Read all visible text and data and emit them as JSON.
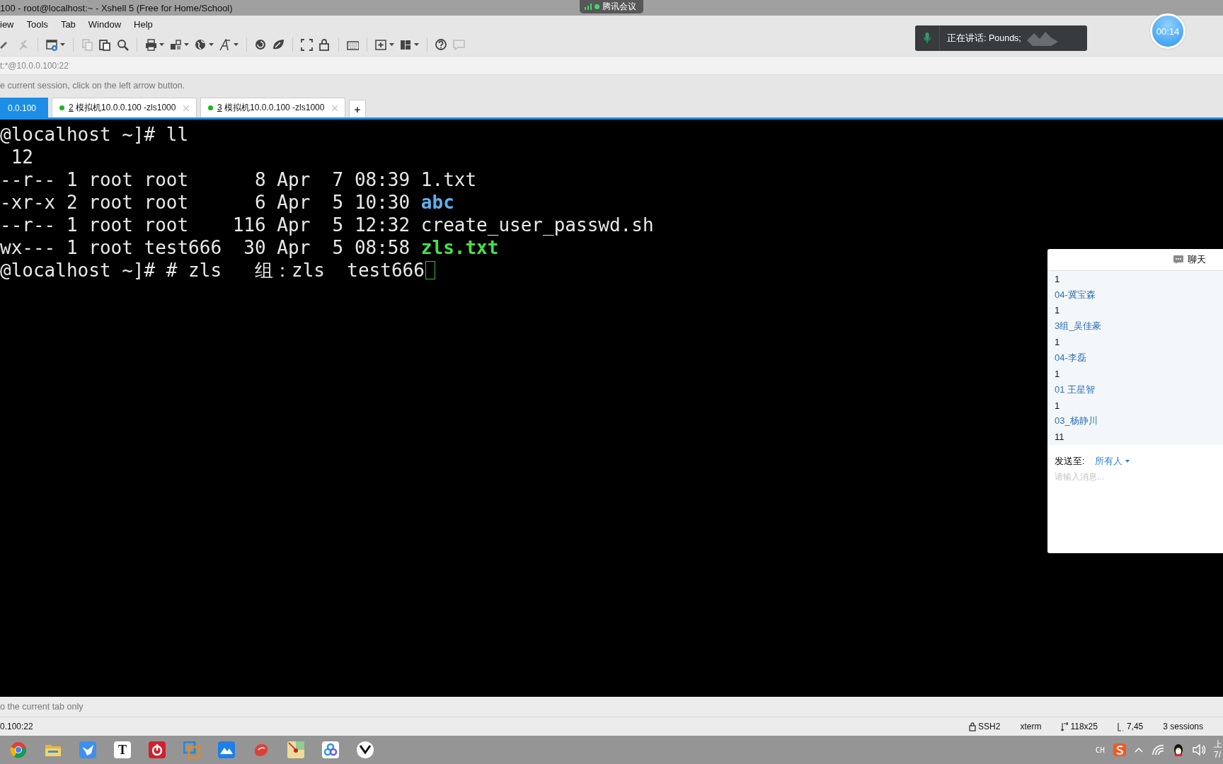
{
  "window": {
    "title": "100 - root@localhost:~ - Xshell 5 (Free for Home/School)"
  },
  "menu": [
    "iew",
    "Tools",
    "Tab",
    "Window",
    "Help"
  ],
  "address": "t:*@10.0.0.100:22",
  "info": "e current session, click on the left arrow button.",
  "tabs": [
    {
      "label": "0.0.100",
      "selected": true,
      "connected": false
    },
    {
      "number": "2",
      "label": " 模拟机10.0.0.100 -zls1000",
      "selected": false,
      "connected": true
    },
    {
      "number": "3",
      "label": " 模拟机10.0.0.100 -zls1000",
      "selected": false,
      "connected": true
    }
  ],
  "new_tab": "+",
  "terminal": {
    "lines": [
      {
        "text": "@localhost ~]# ll"
      },
      {
        "text": " 12"
      },
      {
        "text": "--r-- 1 root root      8 Apr  7 08:39 ",
        "name": "1.txt",
        "kind": "file"
      },
      {
        "text": "-xr-x 2 root root      6 Apr  5 10:30 ",
        "name": "abc",
        "kind": "dir"
      },
      {
        "text": "--r-- 1 root root    116 Apr  5 12:32 ",
        "name": "create_user_passwd.sh",
        "kind": "file"
      },
      {
        "text": "wx--- 1 root test666  30 Apr  5 08:58 ",
        "name": "zls.txt",
        "kind": "exec"
      },
      {
        "text": "@localhost ~]# # zls   组：zls  test666",
        "cursor": true
      }
    ]
  },
  "meeting": {
    "app": "腾讯会议",
    "speaking": "正在讲话: Pounds;",
    "timer": "00:14"
  },
  "chat": {
    "title": "聊天",
    "messages": [
      {
        "kind": "text",
        "text": "1"
      },
      {
        "kind": "name",
        "text": "04-冀宝森"
      },
      {
        "kind": "text",
        "text": "1"
      },
      {
        "kind": "name",
        "text": "3组_吴佳豪"
      },
      {
        "kind": "text",
        "text": "1"
      },
      {
        "kind": "name",
        "text": "04-李磊"
      },
      {
        "kind": "text",
        "text": "1"
      },
      {
        "kind": "name",
        "text": "01 王星智"
      },
      {
        "kind": "text",
        "text": "1"
      },
      {
        "kind": "name",
        "text": "03_杨静川"
      },
      {
        "kind": "text",
        "text": "11"
      }
    ],
    "send_to_label": "发送至:",
    "send_to": "所有人",
    "placeholder": "请输入消息..."
  },
  "hint": "o the current tab only",
  "status_bar": {
    "host": "0.100:22",
    "protocol": "SSH2",
    "term": "xterm",
    "size": "118x25",
    "cursor": "7,45",
    "sessions": "3 sessions"
  },
  "taskbar": {
    "text_icon": "T",
    "ime": "CH",
    "clock": [
      "上",
      "7/"
    ]
  }
}
